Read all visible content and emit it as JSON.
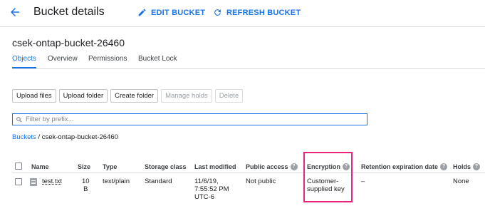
{
  "header": {
    "title": "Bucket details",
    "edit_label": "EDIT BUCKET",
    "refresh_label": "REFRESH BUCKET"
  },
  "bucket": {
    "name": "csek-ontap-bucket-26460"
  },
  "tabs": [
    {
      "label": "Objects",
      "active": true
    },
    {
      "label": "Overview",
      "active": false
    },
    {
      "label": "Permissions",
      "active": false
    },
    {
      "label": "Bucket Lock",
      "active": false
    }
  ],
  "toolbar": {
    "upload_files": "Upload files",
    "upload_folder": "Upload folder",
    "create_folder": "Create folder",
    "manage_holds": "Manage holds",
    "delete": "Delete"
  },
  "filter": {
    "placeholder": "Filter by prefix..."
  },
  "breadcrumb": {
    "root": "Buckets",
    "separator": "/",
    "current": "csek-ontap-bucket-26460"
  },
  "table": {
    "columns": [
      "Name",
      "Size",
      "Type",
      "Storage class",
      "Last modified",
      "Public access",
      "Encryption",
      "Retention expiration date",
      "Holds"
    ],
    "rows": [
      {
        "name": "test.txt",
        "size_line1": "10",
        "size_line2": "B",
        "type": "text/plain",
        "storage_class": "Standard",
        "modified_line1": "11/6/19,",
        "modified_line2": "7:55:52 PM",
        "modified_line3": "UTC-6",
        "public_access": "Not public",
        "encryption_line1": "Customer-",
        "encryption_line2": "supplied key",
        "retention": "–",
        "holds": "None"
      }
    ]
  },
  "colors": {
    "accent": "#1a73e8",
    "highlight": "#e8247c"
  },
  "icons": [
    "back-arrow-icon",
    "edit-pencil-icon",
    "refresh-icon",
    "search-icon",
    "help-icon",
    "file-icon"
  ]
}
